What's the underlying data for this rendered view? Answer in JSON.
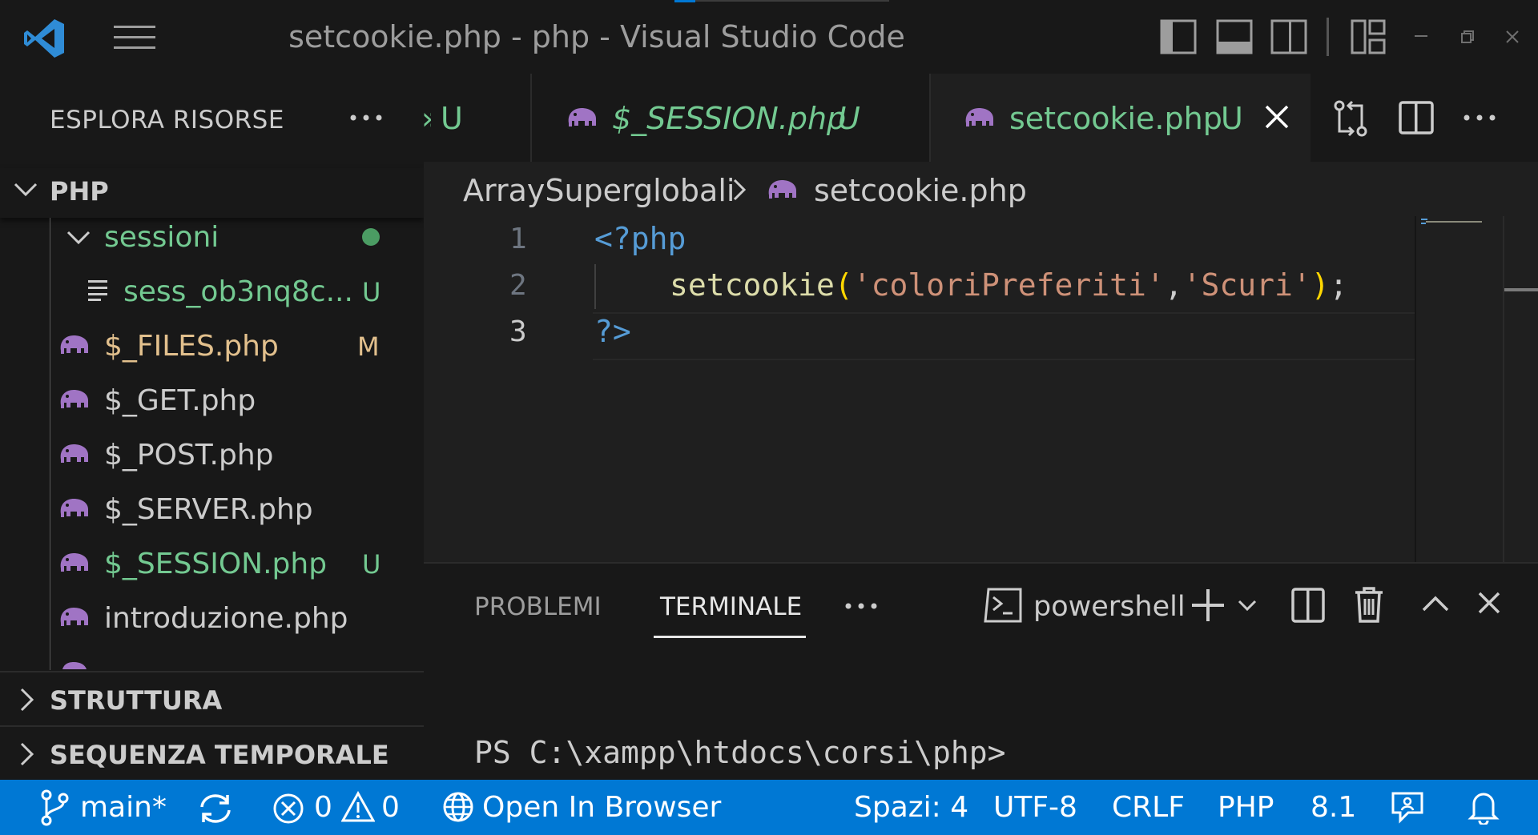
{
  "window": {
    "title": "setcookie.php - php - Visual Studio Code"
  },
  "explorer": {
    "header": "ESPLORA RISORSE",
    "root": "PHP",
    "items": [
      {
        "label": "sessioni",
        "color": "#73c991",
        "badge": "dot"
      },
      {
        "label": "sess_ob3nq8c...",
        "color": "#73c991",
        "badge": "U"
      },
      {
        "label": "$_FILES.php",
        "color": "#e2c08d",
        "badge": "M"
      },
      {
        "label": "$_GET.php",
        "color": "#cccccc",
        "badge": ""
      },
      {
        "label": "$_POST.php",
        "color": "#cccccc",
        "badge": ""
      },
      {
        "label": "$_SERVER.php",
        "color": "#cccccc",
        "badge": ""
      },
      {
        "label": "$_SESSION.php",
        "color": "#73c991",
        "badge": "U"
      },
      {
        "label": "introduzione.php",
        "color": "#cccccc",
        "badge": ""
      }
    ],
    "sections": [
      "STRUTTURA",
      "SEQUENZA TEMPORALE"
    ]
  },
  "tabs": [
    {
      "label": "",
      "badge": "U",
      "active": false
    },
    {
      "label": "$_SESSION.php",
      "badge": "U",
      "active": false
    },
    {
      "label": "setcookie.php",
      "badge": "U",
      "active": true
    }
  ],
  "breadcrumb": {
    "folder": "ArraySuperglobali",
    "file": "setcookie.php"
  },
  "code": {
    "line_numbers": [
      "1",
      "2",
      "3"
    ],
    "line1": "<?php",
    "line2_fn": "setcookie",
    "line2_open": "(",
    "line2_arg1": "'coloriPreferiti'",
    "line2_comma": ",",
    "line2_arg2": "'Scuri'",
    "line2_close": ")",
    "line2_semi": ";",
    "line3": "?>"
  },
  "panel": {
    "tabs": [
      "PROBLEMI",
      "TERMINALE"
    ],
    "shell": "powershell",
    "prompt": "PS C:\\xampp\\htdocs\\corsi\\php>"
  },
  "status": {
    "branch": "main*",
    "errors": "0",
    "warnings": "0",
    "open_in_browser": "Open In Browser",
    "spaces": "Spazi: 4",
    "encoding": "UTF-8",
    "eol": "CRLF",
    "language": "PHP",
    "version": "8.1"
  },
  "colors": {
    "accent": "#0078d4",
    "git_untracked": "#73c991",
    "git_modified": "#e2c08d",
    "php_icon": "#a074c4"
  }
}
